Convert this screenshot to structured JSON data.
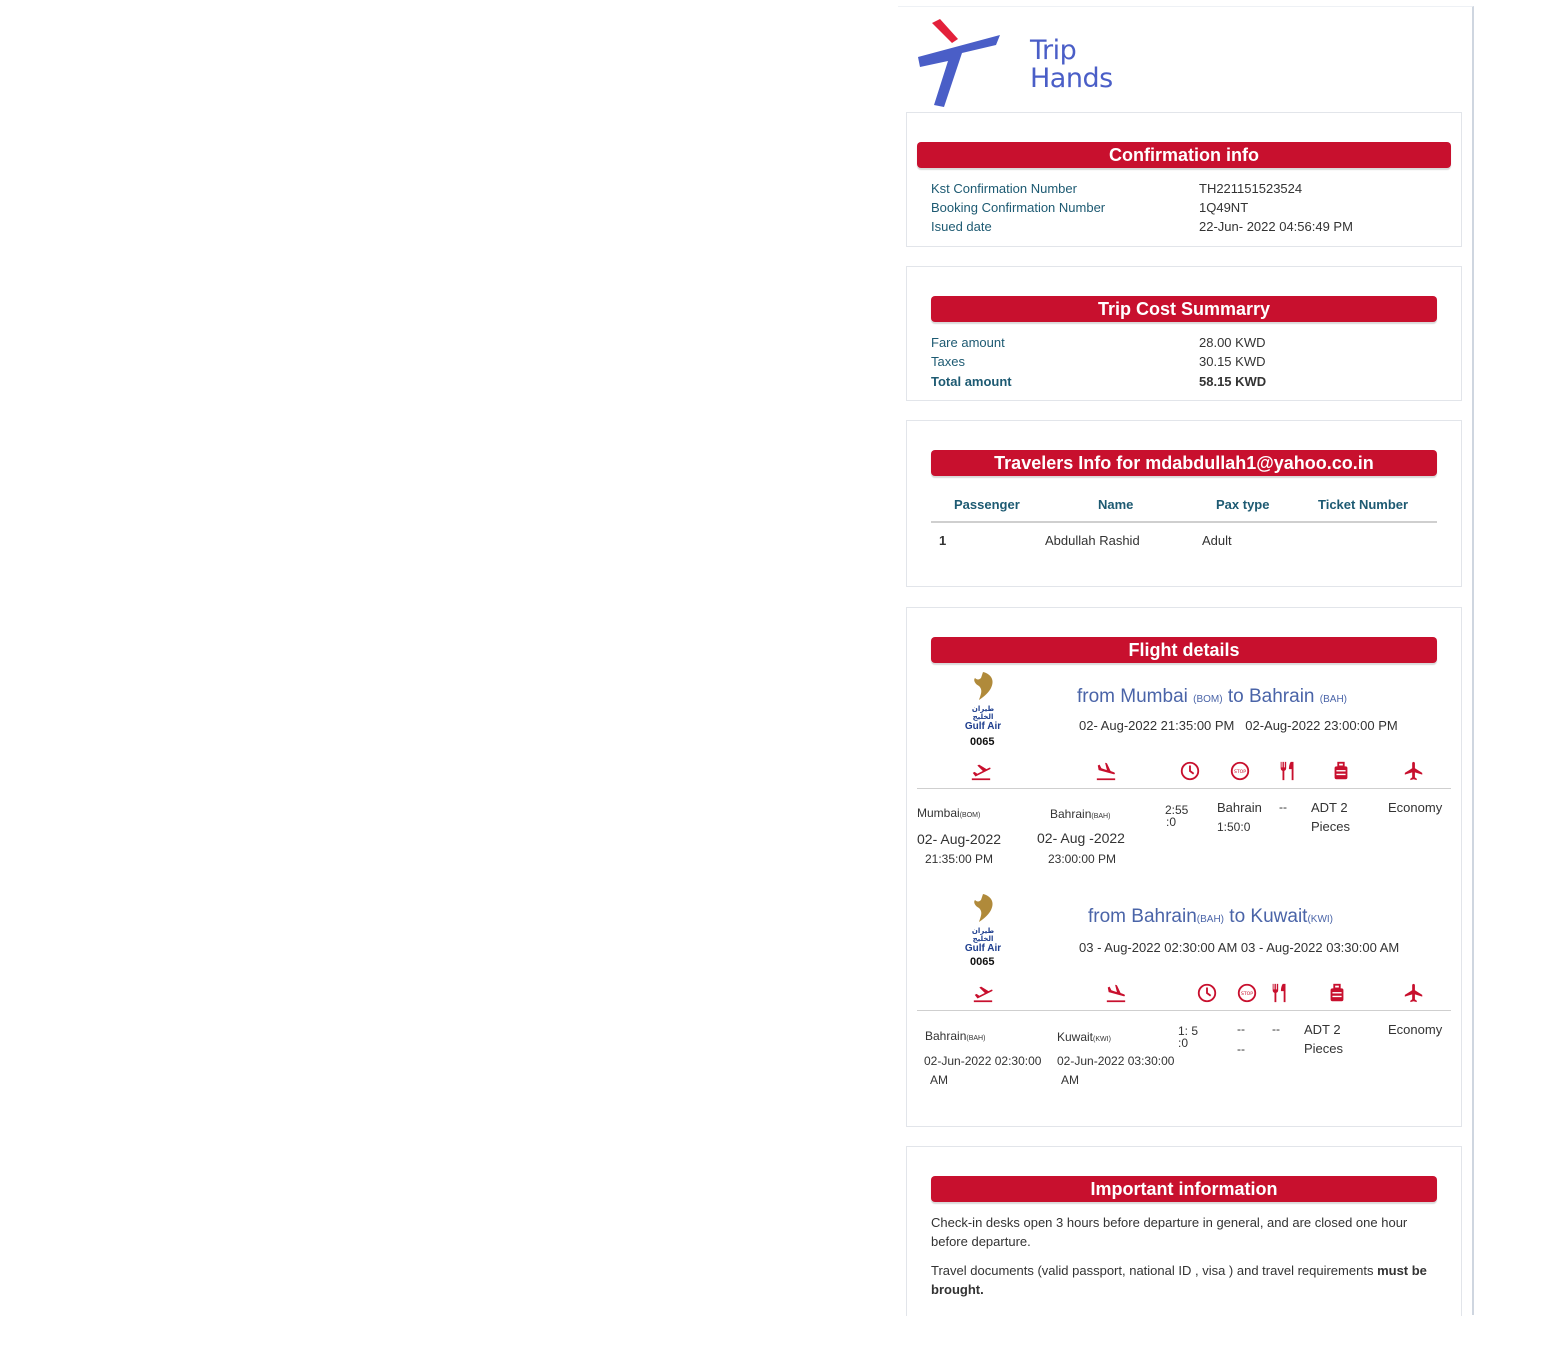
{
  "brand": {
    "logo_line1": "Trip",
    "logo_line2": "Hands",
    "accent": "#c8102e",
    "logo_blue": "#4a5ec7",
    "logo_red": "#e3213b"
  },
  "confirmation": {
    "title": "Confirmation info",
    "rows": [
      {
        "label": "Kst Confirmation Number",
        "value": "TH221151523524"
      },
      {
        "label": "Booking Confirmation Number",
        "value": "1Q49NT"
      },
      {
        "label": "Isued date",
        "value": "22-Jun- 2022 04:56:49 PM"
      }
    ]
  },
  "cost": {
    "title": "Trip Cost Summarry",
    "rows": [
      {
        "label": "Fare amount",
        "value": "28.00 KWD"
      },
      {
        "label": "Taxes",
        "value": "30.15 KWD"
      },
      {
        "label": "Total amount",
        "value": "58.15 KWD"
      }
    ]
  },
  "travelers": {
    "title": "Travelers Info for mdabdullah1@yahoo.co.in",
    "headers": [
      "Passenger",
      "Name",
      "Pax type",
      "Ticket Number"
    ],
    "rows": [
      {
        "passenger": "1",
        "name": "Abdullah Rashid",
        "pax_type": "Adult",
        "ticket": ""
      }
    ]
  },
  "flights": {
    "title": "Flight details",
    "airline_logo_text": "Gulf Air",
    "airline_logo_arabic": "طيران الخليج",
    "segments": [
      {
        "flight_no": "0065",
        "from_city": "from Mumbai",
        "from_code": "(BOM)",
        "to_word": "to Bahrain",
        "to_code": "(BAH)",
        "dep_datetime": "02- Aug-2022 21:35:00 PM",
        "arr_datetime": "02-Aug-2022 23:00:00 PM",
        "dep_city": "Mumbai",
        "dep_city_code": "(BOM)",
        "dep_date": "02- Aug-2022",
        "dep_time": "21:35:00 PM",
        "arr_city": "Bahrain",
        "arr_city_code": "(BAH)",
        "arr_date": "02- Aug -2022",
        "arr_time": "23:00:00 PM",
        "duration_l1": "2:55",
        "duration_l2": ":0",
        "stop_l1": "Bahrain",
        "stop_l2": "1:50:0",
        "meal": "--",
        "baggage_l1": "ADT 2",
        "baggage_l2": "Pieces",
        "cabin": "Economy"
      },
      {
        "flight_no": "0065",
        "from_city": "from Bahrain",
        "from_code": "(BAH)",
        "to_word": "to Kuwait",
        "to_code": "(KWI)",
        "dep_datetime": "03 - Aug-2022 02:30:00 AM",
        "arr_datetime": "03 - Aug-2022 03:30:00 AM",
        "dep_city": "Bahrain",
        "dep_city_code": "(BAH)",
        "dep_date": "02-Jun-2022 02:30:00",
        "dep_time": "AM",
        "arr_city": "Kuwait",
        "arr_city_code": "(KWI)",
        "arr_date": "02-Jun-2022  03:30:00",
        "arr_time": "AM",
        "duration_l1": "1: 5",
        "duration_l2": ":0",
        "stop_l1": "--",
        "stop_l2": "--",
        "meal": "--",
        "baggage_l1": "ADT 2",
        "baggage_l2": "Pieces",
        "cabin": "Economy"
      }
    ],
    "icons": [
      "takeoff-icon",
      "landing-icon",
      "clock-icon",
      "stop-icon",
      "meal-icon",
      "baggage-icon",
      "cabin-plane-icon"
    ]
  },
  "important": {
    "title": "Important information",
    "para1": "Check-in desks open 3 hours before departure in general, and are closed one hour before departure.",
    "para2_a": "Travel documents (valid passport, national ID , visa ) and travel requirements ",
    "para2_b": "must be brought."
  }
}
